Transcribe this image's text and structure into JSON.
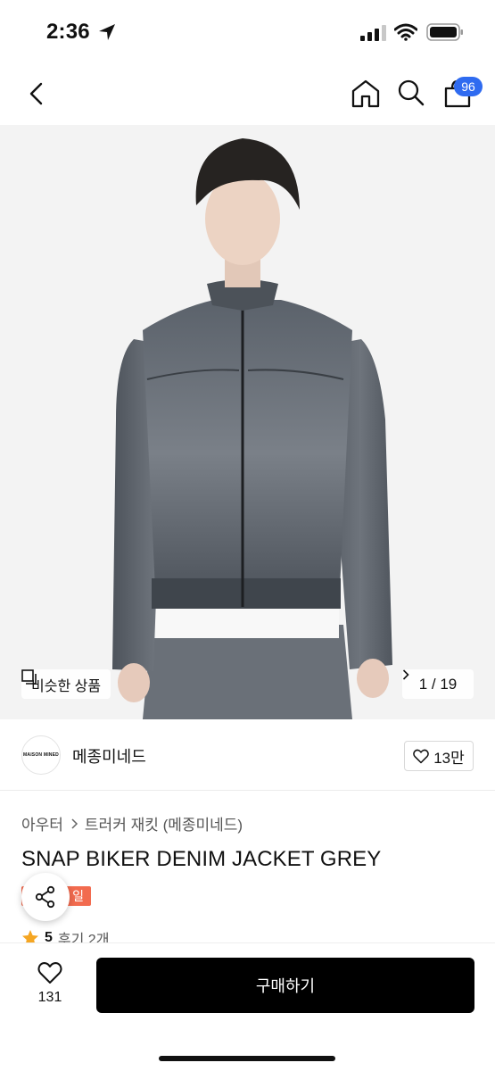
{
  "status_bar": {
    "time": "2:36"
  },
  "nav": {
    "cart_badge": "96"
  },
  "image": {
    "similar_label": "비슷한 상품",
    "counter": "1 / 19"
  },
  "brand": {
    "logo_text": "MAISON MINED",
    "name": "메종미네드",
    "likes": "13만"
  },
  "product": {
    "breadcrumb": [
      "아우터",
      "트러커 재킷 (메종미네드)"
    ],
    "title": "SNAP BIKER DENIM JACKET GREY",
    "tag": "일",
    "rating": "5",
    "reviews": "후기 2개"
  },
  "bottom": {
    "wish_count": "131",
    "buy_label": "구매하기"
  },
  "colors": {
    "accent_blue": "#2f6bf0",
    "tag_orange": "#f26b4f",
    "star": "#f5a623",
    "buy_bg": "#000000"
  },
  "icons": [
    "location-arrow-icon",
    "signal-icon",
    "wifi-icon",
    "battery-icon",
    "back-chevron-icon",
    "home-icon",
    "search-icon",
    "cart-icon",
    "similar-icon",
    "chevron-right-icon",
    "heart-icon",
    "share-icon",
    "star-icon"
  ]
}
